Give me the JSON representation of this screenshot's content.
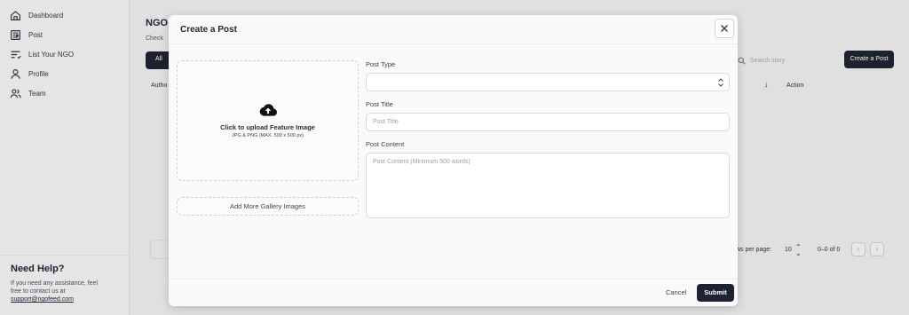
{
  "sidebar": {
    "items": [
      {
        "label": "Dashboard",
        "icon": "home-icon"
      },
      {
        "label": "Post",
        "icon": "newspaper-icon"
      },
      {
        "label": "List Your NGO",
        "icon": "list-icon"
      },
      {
        "label": "Profile",
        "icon": "user-icon"
      },
      {
        "label": "Team",
        "icon": "users-icon"
      }
    ],
    "help": {
      "title": "Need Help?",
      "text": "If you need any assistance, feel free to contact us at",
      "email": "support@ngofeed.com"
    }
  },
  "main": {
    "title": "NGO",
    "subtitle": "Check",
    "tab_all": "All",
    "search_placeholder": "Search story",
    "create_post": "Create a Post",
    "columns": {
      "author": "Autho",
      "sort": "↓",
      "action": "Action"
    },
    "pagination": {
      "rows_label": "ws per page:",
      "rows_value": "10",
      "range": "0–0 of 0"
    }
  },
  "modal": {
    "title": "Create a Post",
    "upload": {
      "title": "Click to upload Feature Image",
      "note": "JPG & PNG (MAX. 500 x 500 px)"
    },
    "gallery_button": "Add More Gallery Images",
    "post_type_label": "Post Type",
    "post_type_value": "",
    "post_title_label": "Post Title",
    "post_title_placeholder": "Post Title",
    "post_content_label": "Post Content",
    "post_content_placeholder": "Post Content (Minimum 500 words)",
    "cancel": "Cancel",
    "submit": "Submit"
  },
  "colors": {
    "primary": "#1f2433",
    "background": "#efefef",
    "modal": "#fafafa"
  }
}
